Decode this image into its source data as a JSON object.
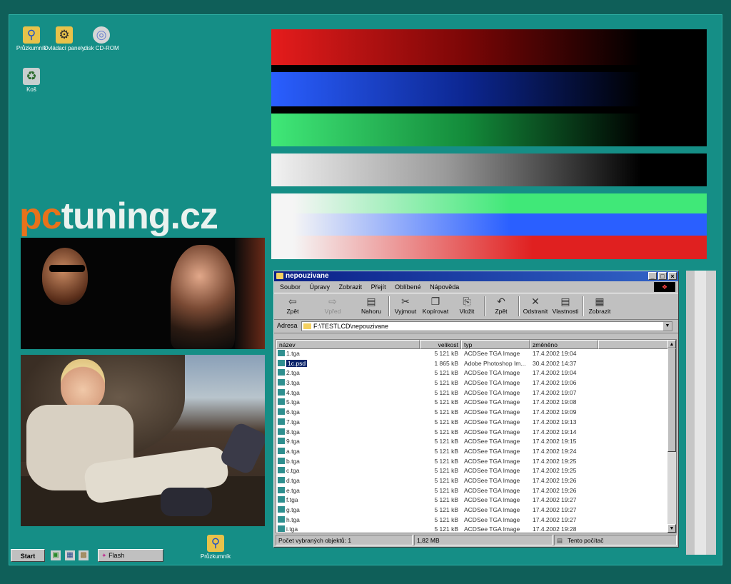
{
  "desktop": {
    "icons": [
      {
        "label": "Průzkumník",
        "icon": "explorer-icon"
      },
      {
        "label": "Ovládací panely",
        "icon": "control-panel-icon"
      },
      {
        "label": "disk CD-ROM",
        "icon": "cd-rom-icon"
      },
      {
        "label": "Koš",
        "icon": "recycle-bin-icon"
      },
      {
        "label": "Průzkumník",
        "icon": "explorer-icon"
      }
    ],
    "logo": {
      "part1": "pc",
      "part2": "tuning.cz"
    }
  },
  "colors": {
    "desktop": "#158e86",
    "red": "#e02020",
    "blue": "#2a5fff",
    "green": "#40e878",
    "white": "#f2f2f2",
    "logo_orange": "#e8721b"
  },
  "taskbar": {
    "start_label": "Start",
    "task_label": "Flash"
  },
  "explorer": {
    "title": "nepouzivane",
    "menu": [
      "Soubor",
      "Úpravy",
      "Zobrazit",
      "Přejít",
      "Oblíbené",
      "Nápověda"
    ],
    "toolbar": [
      "Zpět",
      "Vpřed",
      "Nahoru",
      "Vyjmout",
      "Kopírovat",
      "Vložit",
      "Zpět",
      "Odstranit",
      "Vlastnosti",
      "Zobrazit"
    ],
    "address_label": "Adresa",
    "address_value": "F:\\TESTLCD\\nepouzivane",
    "columns": [
      "název",
      "velikost",
      "typ",
      "změněno"
    ],
    "files": [
      {
        "name": "1.tga",
        "size": "5 121 kB",
        "type": "ACDSee TGA Image",
        "modified": "17.4.2002 19:04"
      },
      {
        "name": "1c.psd",
        "size": "1 865 kB",
        "type": "Adobe Photoshop Im...",
        "modified": "30.4.2002 14:37"
      },
      {
        "name": "2.tga",
        "size": "5 121 kB",
        "type": "ACDSee TGA Image",
        "modified": "17.4.2002 19:04"
      },
      {
        "name": "3.tga",
        "size": "5 121 kB",
        "type": "ACDSee TGA Image",
        "modified": "17.4.2002 19:06"
      },
      {
        "name": "4.tga",
        "size": "5 121 kB",
        "type": "ACDSee TGA Image",
        "modified": "17.4.2002 19:07"
      },
      {
        "name": "5.tga",
        "size": "5 121 kB",
        "type": "ACDSee TGA Image",
        "modified": "17.4.2002 19:08"
      },
      {
        "name": "6.tga",
        "size": "5 121 kB",
        "type": "ACDSee TGA Image",
        "modified": "17.4.2002 19:09"
      },
      {
        "name": "7.tga",
        "size": "5 121 kB",
        "type": "ACDSee TGA Image",
        "modified": "17.4.2002 19:13"
      },
      {
        "name": "8.tga",
        "size": "5 121 kB",
        "type": "ACDSee TGA Image",
        "modified": "17.4.2002 19:14"
      },
      {
        "name": "9.tga",
        "size": "5 121 kB",
        "type": "ACDSee TGA Image",
        "modified": "17.4.2002 19:15"
      },
      {
        "name": "a.tga",
        "size": "5 121 kB",
        "type": "ACDSee TGA Image",
        "modified": "17.4.2002 19:24"
      },
      {
        "name": "b.tga",
        "size": "5 121 kB",
        "type": "ACDSee TGA Image",
        "modified": "17.4.2002 19:25"
      },
      {
        "name": "c.tga",
        "size": "5 121 kB",
        "type": "ACDSee TGA Image",
        "modified": "17.4.2002 19:25"
      },
      {
        "name": "d.tga",
        "size": "5 121 kB",
        "type": "ACDSee TGA Image",
        "modified": "17.4.2002 19:26"
      },
      {
        "name": "e.tga",
        "size": "5 121 kB",
        "type": "ACDSee TGA Image",
        "modified": "17.4.2002 19:26"
      },
      {
        "name": "f.tga",
        "size": "5 121 kB",
        "type": "ACDSee TGA Image",
        "modified": "17.4.2002 19:27"
      },
      {
        "name": "g.tga",
        "size": "5 121 kB",
        "type": "ACDSee TGA Image",
        "modified": "17.4.2002 19:27"
      },
      {
        "name": "h.tga",
        "size": "5 121 kB",
        "type": "ACDSee TGA Image",
        "modified": "17.4.2002 19:27"
      },
      {
        "name": "i.tga",
        "size": "5 121 kB",
        "type": "ACDSee TGA Image",
        "modified": "17.4.2002 19:28"
      }
    ],
    "selected_index": 1,
    "status": {
      "selected": "Počet vybraných objektů: 1",
      "size": "1,82 MB",
      "location": "Tento počítač"
    }
  }
}
